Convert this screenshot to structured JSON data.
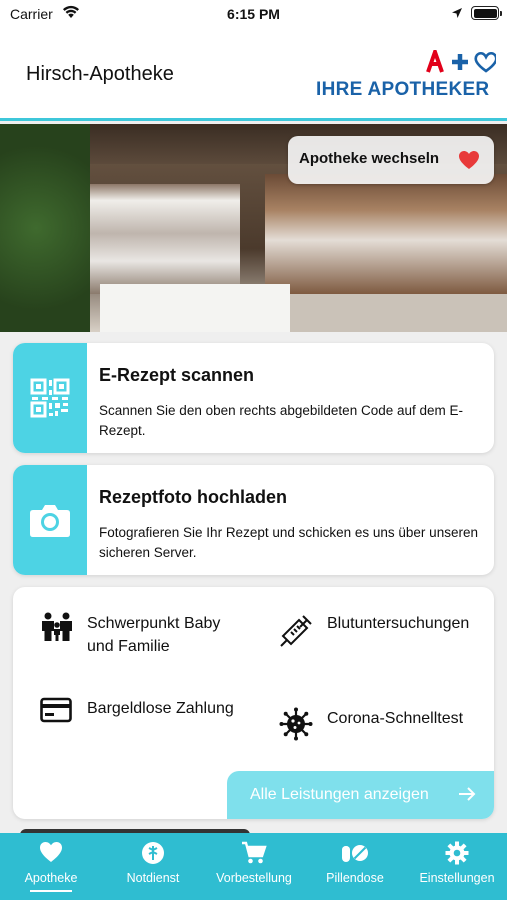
{
  "status_bar": {
    "carrier": "Carrier",
    "time": "6:15 PM"
  },
  "header": {
    "title": "Hirsch-Apotheke",
    "logo_text": "IHRE APOTHEKER",
    "logo_colors": {
      "apotheke_a": "#e2001a",
      "plus": "#1a62a8",
      "heart": "#1a62a8"
    }
  },
  "hero": {
    "change_label": "Apotheke wechseln",
    "heart_color": "#e83a3a"
  },
  "cards": {
    "erezept": {
      "title": "E-Rezept scannen",
      "description": "Scannen Sie den oben rechts abgebildeten Code auf dem E-Rezept.",
      "icon": "qr-code-icon"
    },
    "foto": {
      "title": "Rezeptfoto hochladen",
      "description": "Fotografieren Sie Ihr Rezept und schicken es uns über unseren sicheren Server.",
      "icon": "camera-icon"
    }
  },
  "services": {
    "items": [
      {
        "label": "Schwerpunkt Baby und Familie",
        "icon": "family-icon"
      },
      {
        "label": "Blutuntersuchungen",
        "icon": "syringe-icon"
      },
      {
        "label": "Bargeldlose Zahlung",
        "icon": "credit-card-icon"
      },
      {
        "label": "Corona-Schnelltest",
        "icon": "virus-icon"
      }
    ],
    "all_label": "Alle Leistungen anzeigen"
  },
  "tabbar": {
    "items": [
      {
        "label": "Apotheke",
        "icon": "heart-icon",
        "active": true
      },
      {
        "label": "Notdienst",
        "icon": "emergency-icon",
        "active": false
      },
      {
        "label": "Vorbestellung",
        "icon": "cart-icon",
        "active": false
      },
      {
        "label": "Pillendose",
        "icon": "pills-icon",
        "active": false
      },
      {
        "label": "Einstellungen",
        "icon": "gear-icon",
        "active": false
      }
    ]
  },
  "colors": {
    "accent": "#4dd3e4",
    "tabbar": "#2fbdd1",
    "all_button": "#7fe0ec"
  }
}
